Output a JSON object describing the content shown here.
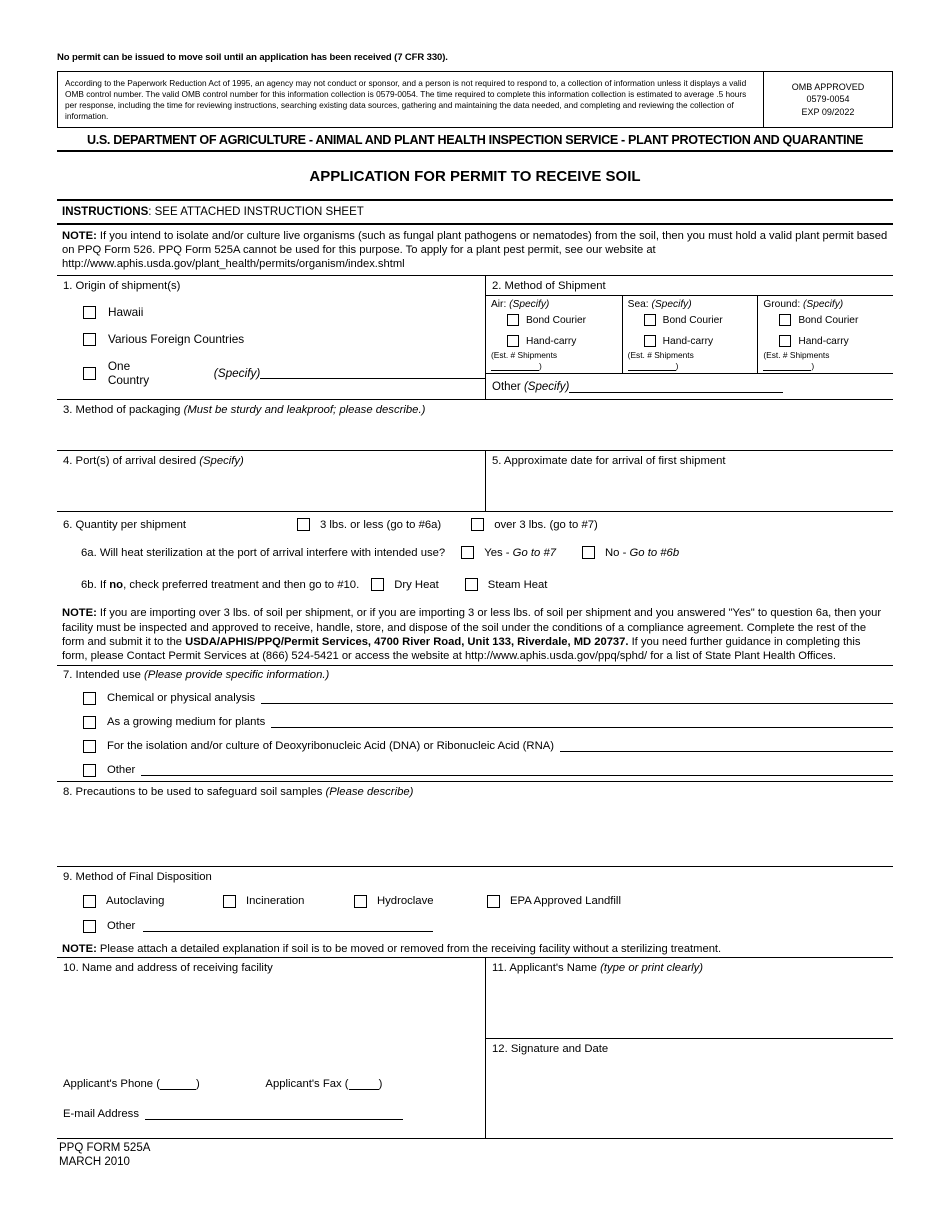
{
  "header": {
    "warning": "No permit can be issued to move soil until an application has been received (7 CFR 330).",
    "paperwork_notice": "According to the Paperwork Reduction Act of 1995, an agency may not conduct or sponsor, and a person is not required to respond to, a collection of information unless it displays a valid OMB control number. The valid OMB control number for this information collection is 0579-0054. The time required to complete this information collection is estimated to average .5 hours per response, including the time for reviewing instructions, searching existing data sources, gathering and maintaining the data needed, and completing and reviewing the collection of information.",
    "omb_approved": "OMB APPROVED",
    "omb_number": "0579-0054",
    "omb_expiration": "EXP 09/2022",
    "agency_line": "U.S. DEPARTMENT OF AGRICULTURE - ANIMAL AND PLANT HEALTH INSPECTION SERVICE - PLANT PROTECTION AND QUARANTINE",
    "form_title": "APPLICATION FOR PERMIT TO RECEIVE SOIL"
  },
  "instructions": {
    "label": "INSTRUCTIONS",
    "text": ": SEE ATTACHED INSTRUCTION SHEET"
  },
  "note_top": {
    "label": "NOTE:",
    "text": " If you intend to isolate and/or culture live organisms (such as fungal plant pathogens or nematodes) from the soil, then you must hold a valid plant permit based on PPQ Form 526. PPQ Form 525A cannot be used for this purpose. To apply for a plant pest permit, see our website at http://www.aphis.usda.gov/plant_health/permits/organism/index.shtml"
  },
  "section1": {
    "title": "1. Origin of shipment(s)",
    "options": [
      {
        "label": "Hawaii"
      },
      {
        "label": "Various Foreign Countries"
      },
      {
        "label": "One Country"
      }
    ],
    "specify_label": "(Specify)"
  },
  "section2": {
    "title": "2. Method of Shipment",
    "columns": [
      {
        "heading_prefix": "Air: ",
        "heading_specify": "(Specify)",
        "bond_courier": "Bond Courier",
        "hand_carry": "Hand-carry",
        "est_line1": "(Est.  # Shipments",
        "est_line2": ")"
      },
      {
        "heading_prefix": "Sea: ",
        "heading_specify": "(Specify)",
        "bond_courier": "Bond Courier",
        "hand_carry": "Hand-carry",
        "est_line1": "(Est.  # Shipments",
        "est_line2": ")"
      },
      {
        "heading_prefix": "Ground: ",
        "heading_specify": "(Specify)",
        "bond_courier": "Bond Courier",
        "hand_carry": "Hand-carry",
        "est_line1": "(Est.  # Shipments",
        "est_line2": ")"
      }
    ],
    "other_label": "Other ",
    "other_specify": "(Specify)"
  },
  "section3": {
    "title": "3. Method of packaging ",
    "title_italic": "(Must be sturdy and leakproof; please describe.)"
  },
  "section4": {
    "title": "4. Port(s) of arrival desired ",
    "title_italic": "(Specify)"
  },
  "section5": {
    "title": "5. Approximate date for arrival of first shipment"
  },
  "section6": {
    "title": "6. Quantity per shipment",
    "opt_small": "3 lbs. or less (go to #6a)",
    "opt_large": "over 3 lbs. (go to #7)",
    "q6a_text": "6a. Will heat sterilization at the port of arrival interfere with intended use?",
    "q6a_yes_prefix": "Yes - ",
    "q6a_yes_italic": "Go to #7",
    "q6a_no_prefix": "No - ",
    "q6a_no_italic": "Go to #6b",
    "q6b_prefix": "6b. If ",
    "q6b_bold": "no",
    "q6b_suffix": ", check preferred treatment and then go to #10.",
    "q6b_dry": "Dry Heat",
    "q6b_steam": "Steam Heat"
  },
  "note_middle": {
    "label": "NOTE:",
    "part1": " If you are importing over 3 lbs. of soil per shipment, or if you are importing 3 or less lbs. of soil per shipment and you answered \"Yes\" to question 6a, then your facility must be inspected and approved to receive, handle, store, and dispose of the soil under the conditions of a compliance agreement. Complete the rest of the form and submit it to the ",
    "address_bold": "USDA/APHIS/PPQ/Permit Services, 4700 River Road, Unit 133, Riverdale, MD 20737.",
    "part2": "  If you need further guidance in completing this form, please Contact Permit Services at (866) 524-5421 or access the website at http://www.aphis.usda.gov/ppq/sphd/ for a list of State Plant Health Offices."
  },
  "section7": {
    "title": "7. Intended use ",
    "title_italic": "(Please provide specific information.)",
    "options": [
      {
        "label": "Chemical or physical analysis"
      },
      {
        "label": "As a growing medium for plants"
      },
      {
        "label": "For the isolation and/or culture of Deoxyribonucleic Acid (DNA) or Ribonucleic Acid (RNA)"
      },
      {
        "label": "Other"
      }
    ]
  },
  "section8": {
    "title": "8. Precautions to be used to safeguard soil samples ",
    "title_italic": "(Please describe)"
  },
  "section9": {
    "title": "9. Method of Final Disposition",
    "options": [
      {
        "label": "Autoclaving"
      },
      {
        "label": "Incineration"
      },
      {
        "label": "Hydroclave"
      },
      {
        "label": "EPA Approved Landfill"
      }
    ],
    "other_label": "Other"
  },
  "note_bottom": {
    "label": "NOTE:",
    "text": " Please attach a detailed explanation if soil is to be moved or removed from the receiving facility without a sterilizing treatment."
  },
  "section10": {
    "title": "10. Name and address of receiving facility",
    "phone_label": "Applicant's Phone (",
    "phone_close": ")",
    "fax_label": "Applicant's Fax (",
    "fax_close": ")",
    "email_label": "E-mail Address"
  },
  "section11": {
    "title": "11. Applicant's Name ",
    "title_italic": "(type or print clearly)"
  },
  "section12": {
    "title": "12. Signature and Date"
  },
  "footer": {
    "form_number": "PPQ FORM 525A",
    "form_date": "MARCH 2010"
  }
}
